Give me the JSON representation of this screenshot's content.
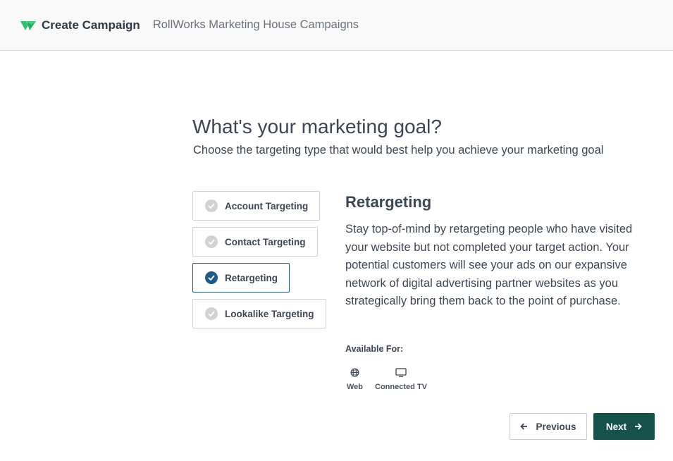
{
  "header": {
    "title": "Create Campaign",
    "subtitle": "RollWorks Marketing House Campaigns"
  },
  "main": {
    "heading": "What's your marketing goal?",
    "subheading": "Choose the targeting type that would best help you achieve your marketing goal"
  },
  "options": [
    {
      "label": "Account Targeting",
      "selected": false
    },
    {
      "label": "Contact Targeting",
      "selected": false
    },
    {
      "label": "Retargeting",
      "selected": true
    },
    {
      "label": "Lookalike Targeting",
      "selected": false
    }
  ],
  "detail": {
    "title": "Retargeting",
    "description": "Stay top-of-mind by retargeting people who have visited your website but not completed your target action. Your potential customers will see your ads on our expansive network of digital advertising partner websites as you strategically bring them back to the point of purchase.",
    "available_label": "Available For:",
    "platforms": [
      {
        "label": "Web",
        "icon": "globe-icon"
      },
      {
        "label": "Connected TV",
        "icon": "monitor-icon"
      }
    ]
  },
  "footer": {
    "previous_label": "Previous",
    "next_label": "Next"
  },
  "colors": {
    "logo_green": "#2fbf71",
    "selected_border": "#2b5d87",
    "selected_check": "#1e5a8c",
    "next_button": "#14524a"
  }
}
